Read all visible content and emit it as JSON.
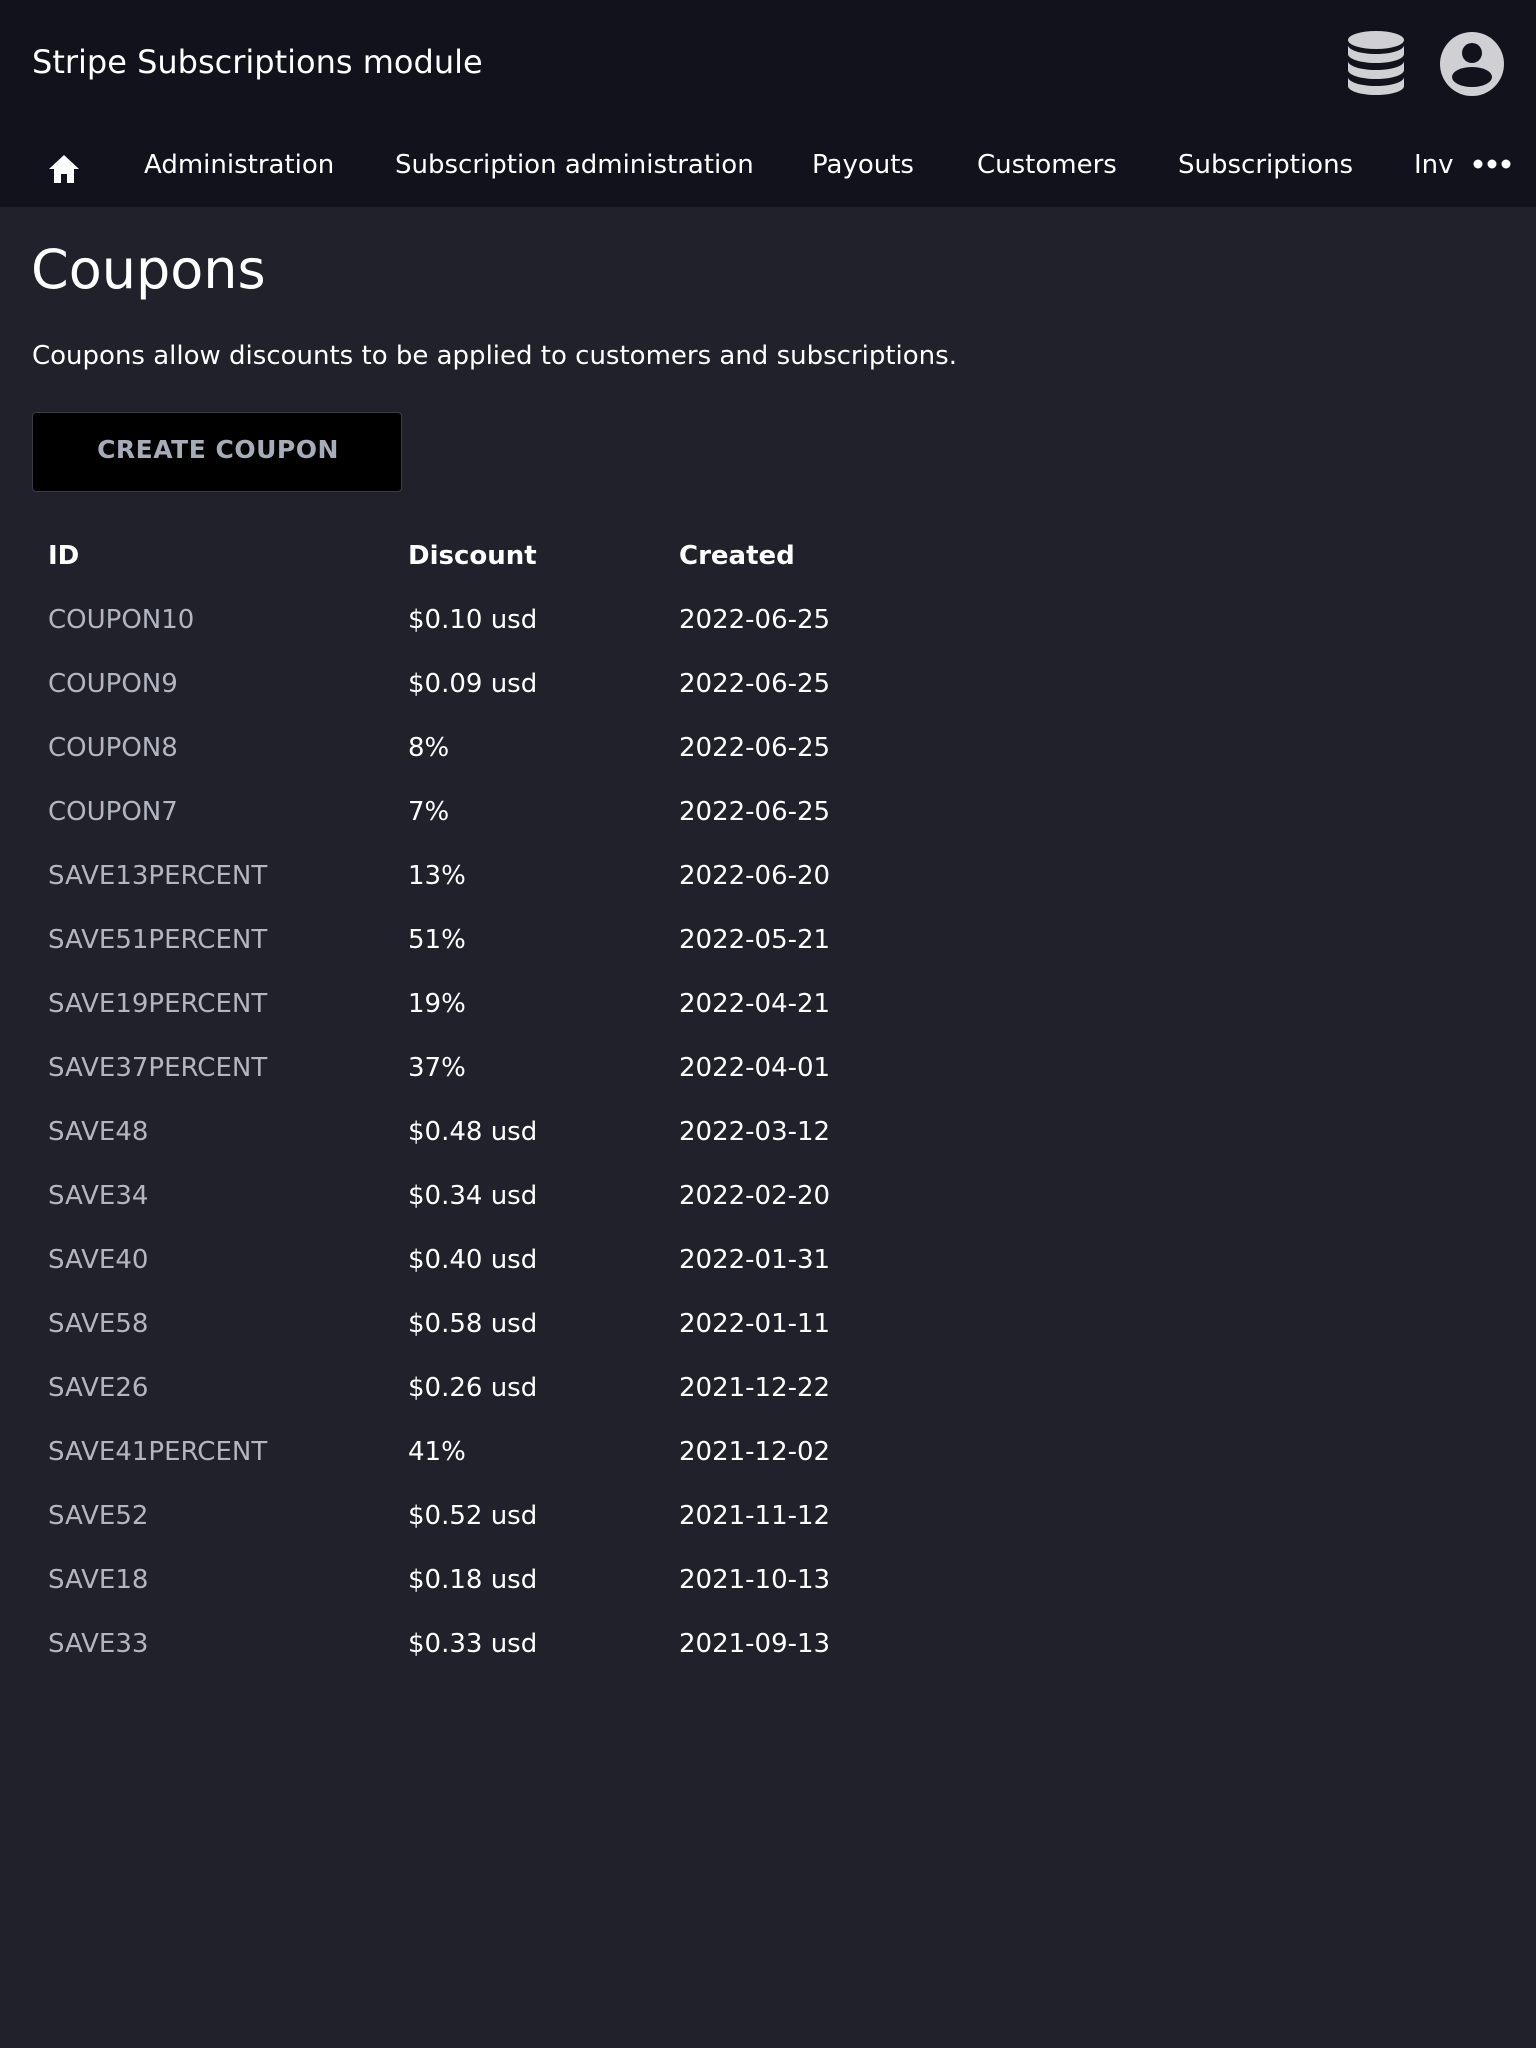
{
  "header": {
    "title": "Stripe Subscriptions module",
    "icons": [
      "database-icon",
      "account-circle-icon"
    ]
  },
  "nav": {
    "home_icon": "home-icon",
    "items": [
      "Administration",
      "Subscription administration",
      "Payouts",
      "Customers",
      "Subscriptions",
      "Invoices"
    ],
    "more_icon": "more-horizontal-icon"
  },
  "page": {
    "title": "Coupons",
    "description": "Coupons allow discounts to be applied to customers and subscriptions.",
    "create_button": "CREATE COUPON"
  },
  "table": {
    "headers": [
      "ID",
      "Discount",
      "Created"
    ],
    "rows": [
      [
        "COUPON10",
        "$0.10 usd",
        "2022-06-25"
      ],
      [
        "COUPON9",
        "$0.09 usd",
        "2022-06-25"
      ],
      [
        "COUPON8",
        "8%",
        "2022-06-25"
      ],
      [
        "COUPON7",
        "7%",
        "2022-06-25"
      ],
      [
        "SAVE13PERCENT",
        "13%",
        "2022-06-20"
      ],
      [
        "SAVE51PERCENT",
        "51%",
        "2022-05-21"
      ],
      [
        "SAVE19PERCENT",
        "19%",
        "2022-04-21"
      ],
      [
        "SAVE37PERCENT",
        "37%",
        "2022-04-01"
      ],
      [
        "SAVE48",
        "$0.48 usd",
        "2022-03-12"
      ],
      [
        "SAVE34",
        "$0.34 usd",
        "2022-02-20"
      ],
      [
        "SAVE40",
        "$0.40 usd",
        "2022-01-31"
      ],
      [
        "SAVE58",
        "$0.58 usd",
        "2022-01-11"
      ],
      [
        "SAVE26",
        "$0.26 usd",
        "2021-12-22"
      ],
      [
        "SAVE41PERCENT",
        "41%",
        "2021-12-02"
      ],
      [
        "SAVE52",
        "$0.52 usd",
        "2021-11-12"
      ],
      [
        "SAVE18",
        "$0.18 usd",
        "2021-10-13"
      ],
      [
        "SAVE33",
        "$0.33 usd",
        "2021-09-13"
      ]
    ]
  },
  "colors": {
    "background": "#21212b",
    "header": "#12121c",
    "link": "#b1b6c1",
    "button": "#000000",
    "button_text": "#a7adb8"
  }
}
